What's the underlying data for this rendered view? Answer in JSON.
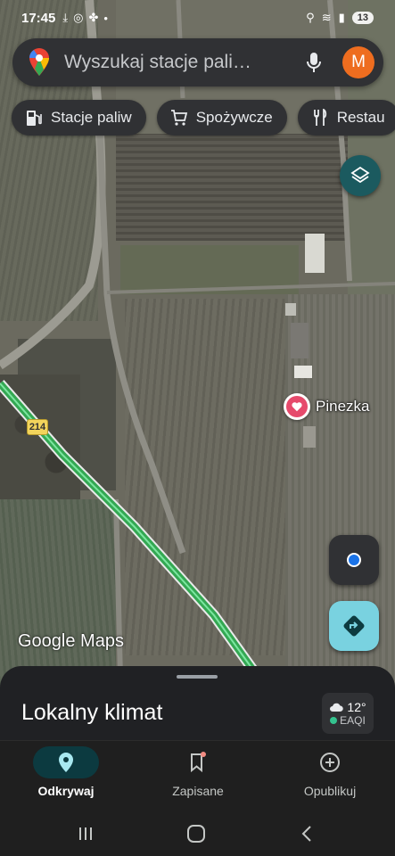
{
  "status_bar": {
    "time": "17:45",
    "battery": "13"
  },
  "search": {
    "placeholder": "Wyszukaj stacje pali…",
    "avatar_letter": "M"
  },
  "chips": [
    {
      "label": "Stacje paliw",
      "icon": "gas-station-icon"
    },
    {
      "label": "Spożywcze",
      "icon": "cart-icon"
    },
    {
      "label": "Restau",
      "icon": "restaurant-icon"
    }
  ],
  "map": {
    "route_number": "214",
    "pin_label": "Pinezka",
    "watermark": "Google Maps"
  },
  "sheet": {
    "title": "Lokalny klimat",
    "temperature": "12°",
    "air_quality": "EAQI"
  },
  "bottom_nav": [
    {
      "label": "Odkrywaj",
      "icon": "location-pin-icon",
      "active": true
    },
    {
      "label": "Zapisane",
      "icon": "bookmark-icon",
      "active": false
    },
    {
      "label": "Opublikuj",
      "icon": "add-circle-icon",
      "active": false
    }
  ],
  "colors": {
    "accent": "#0c3a40",
    "avatar": "#ee6d1f",
    "directions": "#79d2e0",
    "route": "#34a853"
  }
}
